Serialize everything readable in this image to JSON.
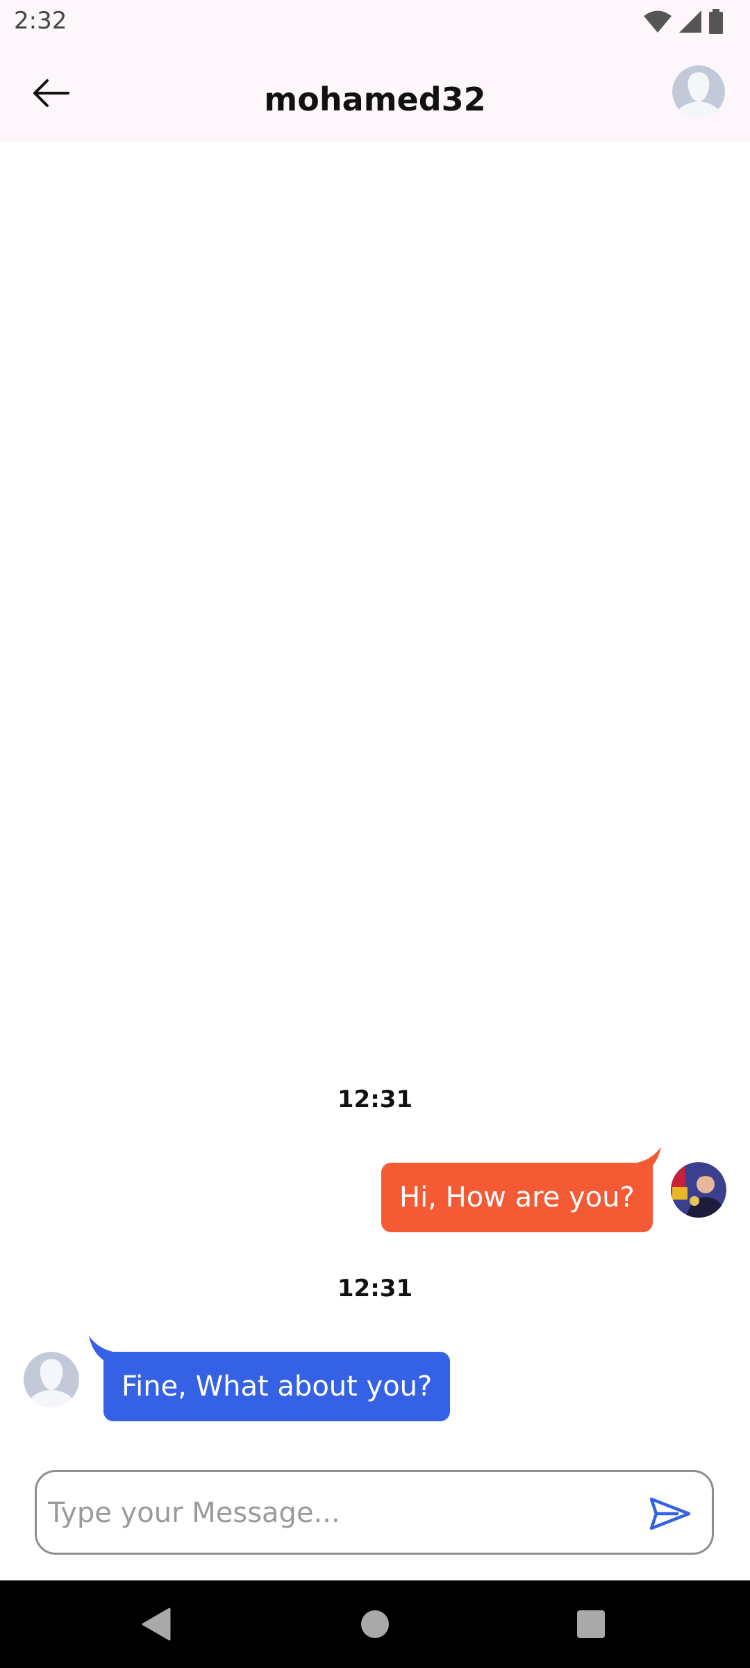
{
  "status_bar": {
    "time": "2:32",
    "icons": [
      "wifi-icon",
      "cell-signal-icon",
      "battery-icon"
    ]
  },
  "header": {
    "back_icon": "arrow-left-icon",
    "title": "mohamed32",
    "avatar_icon": "default-avatar-icon"
  },
  "messages": [
    {
      "timestamp": "12:31",
      "direction": "sent",
      "text": "Hi, How are you?",
      "color": "#f45a33"
    },
    {
      "timestamp": "12:31",
      "direction": "received",
      "text": "Fine, What about you?",
      "color": "#3562e4"
    }
  ],
  "composer": {
    "placeholder": "Type your Message...",
    "value": "",
    "send_icon": "send-icon",
    "accent": "#3562e4"
  },
  "nav_bar": {
    "buttons": [
      "back-triangle-icon",
      "home-circle-icon",
      "recents-square-icon"
    ]
  }
}
